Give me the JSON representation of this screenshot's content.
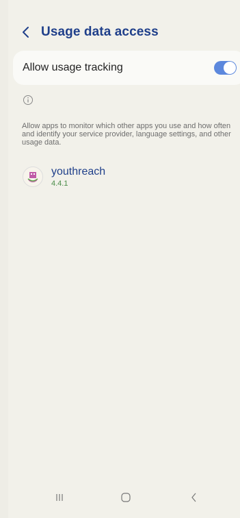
{
  "header": {
    "title": "Usage data access"
  },
  "setting": {
    "label": "Allow usage tracking",
    "enabled": true
  },
  "description": "Allow apps to monitor which other apps you use and how often and identify your service provider, language settings, and other usage data.",
  "apps": [
    {
      "name": "youthreach",
      "version": "4.4.1"
    }
  ],
  "colors": {
    "accent": "#1f3f8a",
    "toggle": "#5c88dd",
    "version": "#4a8c48",
    "background": "#f2f1ea"
  },
  "nav": {
    "recents_icon": "recents-icon",
    "home_icon": "home-icon",
    "back_icon": "back-icon"
  }
}
